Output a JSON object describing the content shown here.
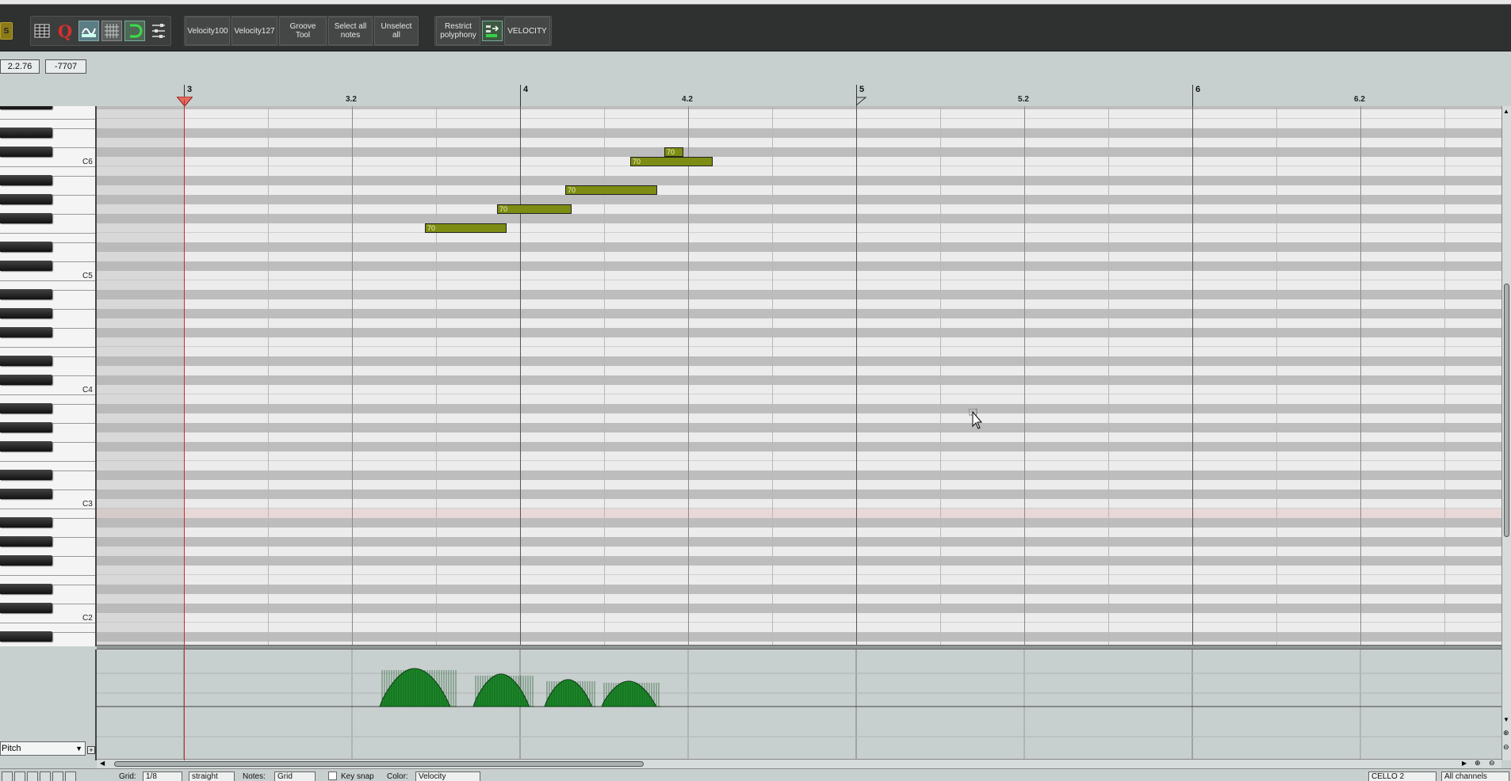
{
  "toolbar": {
    "buttons": {
      "velocity100": "Velocity100",
      "velocity127": "Velocity127",
      "groove_tool": "Groove Tool",
      "select_all_notes": "Select all notes",
      "unselect_all": "Unselect all",
      "restrict_polyphony": "Restrict polyphony",
      "velocity": "VELOCITY"
    },
    "icons": [
      "solo-s-icon",
      "grid-list-icon",
      "quantize-q-icon",
      "humanize-icon",
      "piano-grid-icon",
      "magnet-snap-icon",
      "settings-sliders-icon",
      "polyphony-arrow-icon"
    ],
    "solo_label": "S",
    "quantize_label": "Q"
  },
  "position": {
    "time": "2.2.76",
    "value": "-7707"
  },
  "ruler": {
    "measures": [
      "3",
      "4",
      "5",
      "6"
    ],
    "beats": [
      "3.2",
      "4.2",
      "5.2",
      "6.2"
    ]
  },
  "keyboard": {
    "labels": [
      "C6",
      "C5",
      "C4",
      "C3",
      "C2"
    ]
  },
  "notes": [
    {
      "velocity": "70",
      "pitch": "F5",
      "start": "4",
      "end": "4.1.56"
    },
    {
      "velocity": "70",
      "pitch": "G5",
      "start": "4.1.50",
      "end": "4.2.04"
    },
    {
      "velocity": "70",
      "pitch": "A5",
      "start": "4.2",
      "end": "4.2.66"
    },
    {
      "velocity": "70",
      "pitch": "C6",
      "start": "4.2.50",
      "end": "5.0.06"
    },
    {
      "velocity": "70",
      "pitch": "C#6",
      "start": "4.2.75",
      "end": "4.2.89"
    }
  ],
  "cc_lane": {
    "selected": "Pitch",
    "options": [
      "Pitch",
      "Velocity"
    ]
  },
  "status": {
    "grid_label": "Grid:",
    "grid_value": "1/8",
    "grid_type": "straight",
    "notes_label": "Notes:",
    "notes_value": "Grid",
    "keysnap_label": "Key snap",
    "color_label": "Color:",
    "color_value": "Velocity",
    "track_value": "CELLO 2",
    "channels_value": "All channels"
  },
  "colors": {
    "note_fill": "#7d8c12",
    "cc_green": "#1d8a2a",
    "cursor": "#c0302b",
    "highlight_row": "#e8d8d8"
  }
}
